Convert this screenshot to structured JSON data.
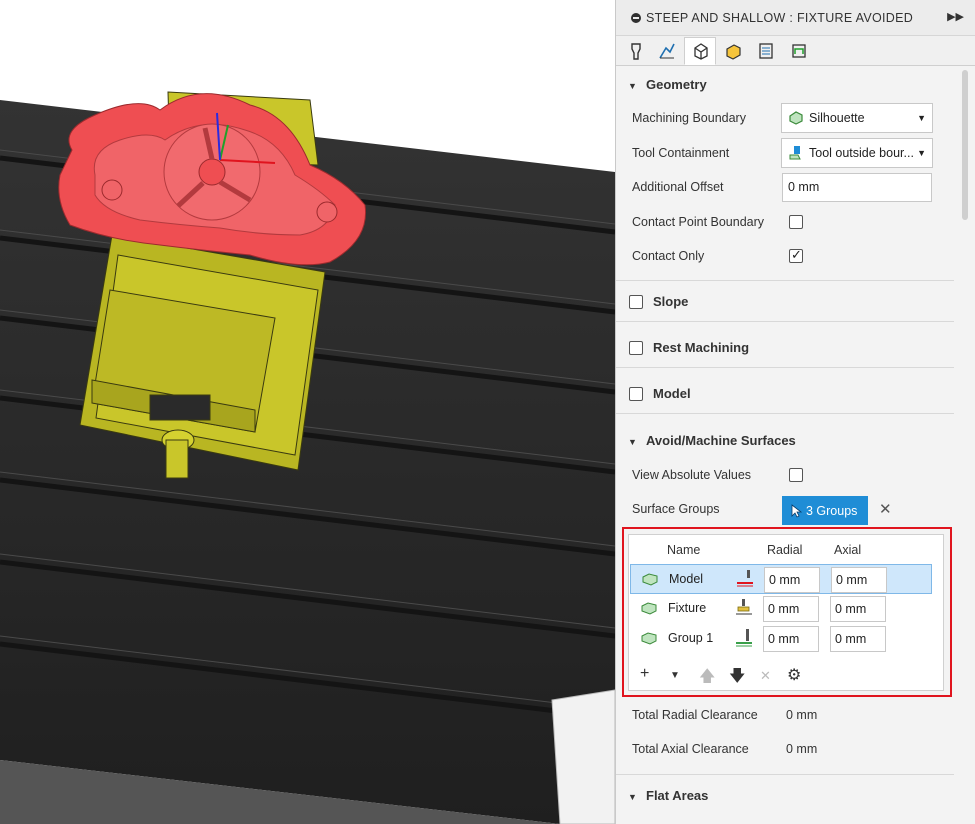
{
  "panel": {
    "title": "STEEP AND SHALLOW : FIXTURE AVOIDED",
    "tabs": [
      "tool-tab",
      "shape-tab",
      "geometry-tab",
      "heights-tab",
      "passes-tab",
      "linking-tab"
    ],
    "geometry": {
      "header": "Geometry",
      "machining_boundary_label": "Machining Boundary",
      "machining_boundary_value": "Silhouette",
      "tool_containment_label": "Tool Containment",
      "tool_containment_value": "Tool outside bour...",
      "additional_offset_label": "Additional Offset",
      "additional_offset_value": "0 mm",
      "contact_point_boundary_label": "Contact Point Boundary",
      "contact_only_label": "Contact Only"
    },
    "slope_label": "Slope",
    "rest_machining_label": "Rest Machining",
    "model_label": "Model",
    "avoid": {
      "header": "Avoid/Machine Surfaces",
      "view_absolute_label": "View Absolute Values",
      "surface_groups_label": "Surface Groups",
      "surface_groups_button": "3 Groups",
      "table": {
        "headers": {
          "name": "Name",
          "radial": "Radial",
          "axial": "Axial"
        },
        "rows": [
          {
            "name": "Model",
            "radial": "0 mm",
            "axial": "0 mm"
          },
          {
            "name": "Fixture",
            "radial": "0 mm",
            "axial": "0 mm"
          },
          {
            "name": "Group 1",
            "radial": "0 mm",
            "axial": "0 mm"
          }
        ]
      },
      "total_radial_label": "Total Radial Clearance",
      "total_radial_value": "0 mm",
      "total_axial_label": "Total Axial Clearance",
      "total_axial_value": "0 mm"
    },
    "flat_areas_label": "Flat Areas"
  },
  "colors": {
    "accent": "#1f8dd6",
    "highlight_border": "#e0141e",
    "part": "#ef4e52",
    "vise": "#c9c62a",
    "table": "#2c2c2c"
  }
}
